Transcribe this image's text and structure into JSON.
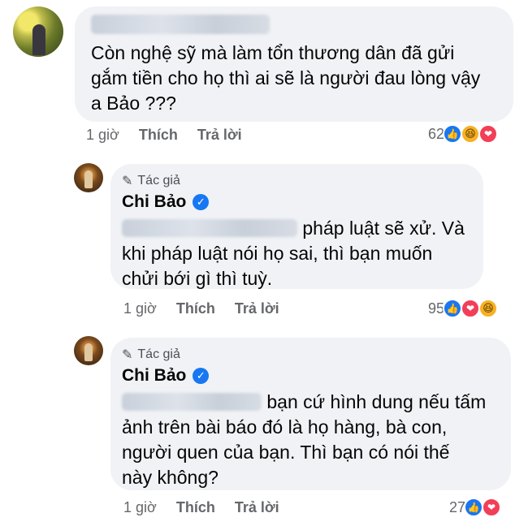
{
  "comment1": {
    "text_lines": [
      "Còn nghệ sỹ mà làm tổn thương dân đã gửi",
      "gắm tiền cho họ thì ai sẽ là người đau lòng vậy",
      "a Bảo ???"
    ],
    "time": "1 giờ",
    "like_label": "Thích",
    "reply_label": "Trả lời",
    "reaction_count": "62",
    "reactions": [
      "like-icon",
      "haha-icon",
      "love-icon"
    ]
  },
  "reply1": {
    "author_tag": "Tác giả",
    "author_name": "Chi Bảo",
    "text_first": "pháp luật sẽ xử. Và",
    "text_lines": [
      "khi pháp luật nói họ sai, thì bạn muốn",
      "chửi bới gì thì tuỳ."
    ],
    "time": "1 giờ",
    "like_label": "Thích",
    "reply_label": "Trả lời",
    "reaction_count": "95",
    "reactions": [
      "like-icon",
      "love-icon",
      "haha-icon"
    ]
  },
  "reply2": {
    "author_tag": "Tác giả",
    "author_name": "Chi Bảo",
    "text_first": "bạn cứ hình dung nếu tấm",
    "text_lines": [
      "ảnh trên bài báo đó là họ hàng, bà con,",
      "người quen của bạn. Thì bạn có nói thế",
      "này không?"
    ],
    "time": "1 giờ",
    "like_label": "Thích",
    "reply_label": "Trả lời",
    "reaction_count": "27",
    "reactions": [
      "like-icon",
      "love-icon"
    ]
  },
  "colors": {
    "bubble": "#f0f2f5",
    "meta": "#65676b",
    "verified": "#1877f2",
    "like": "#1877f2",
    "love": "#f33e58",
    "haha": "#f7b125"
  }
}
